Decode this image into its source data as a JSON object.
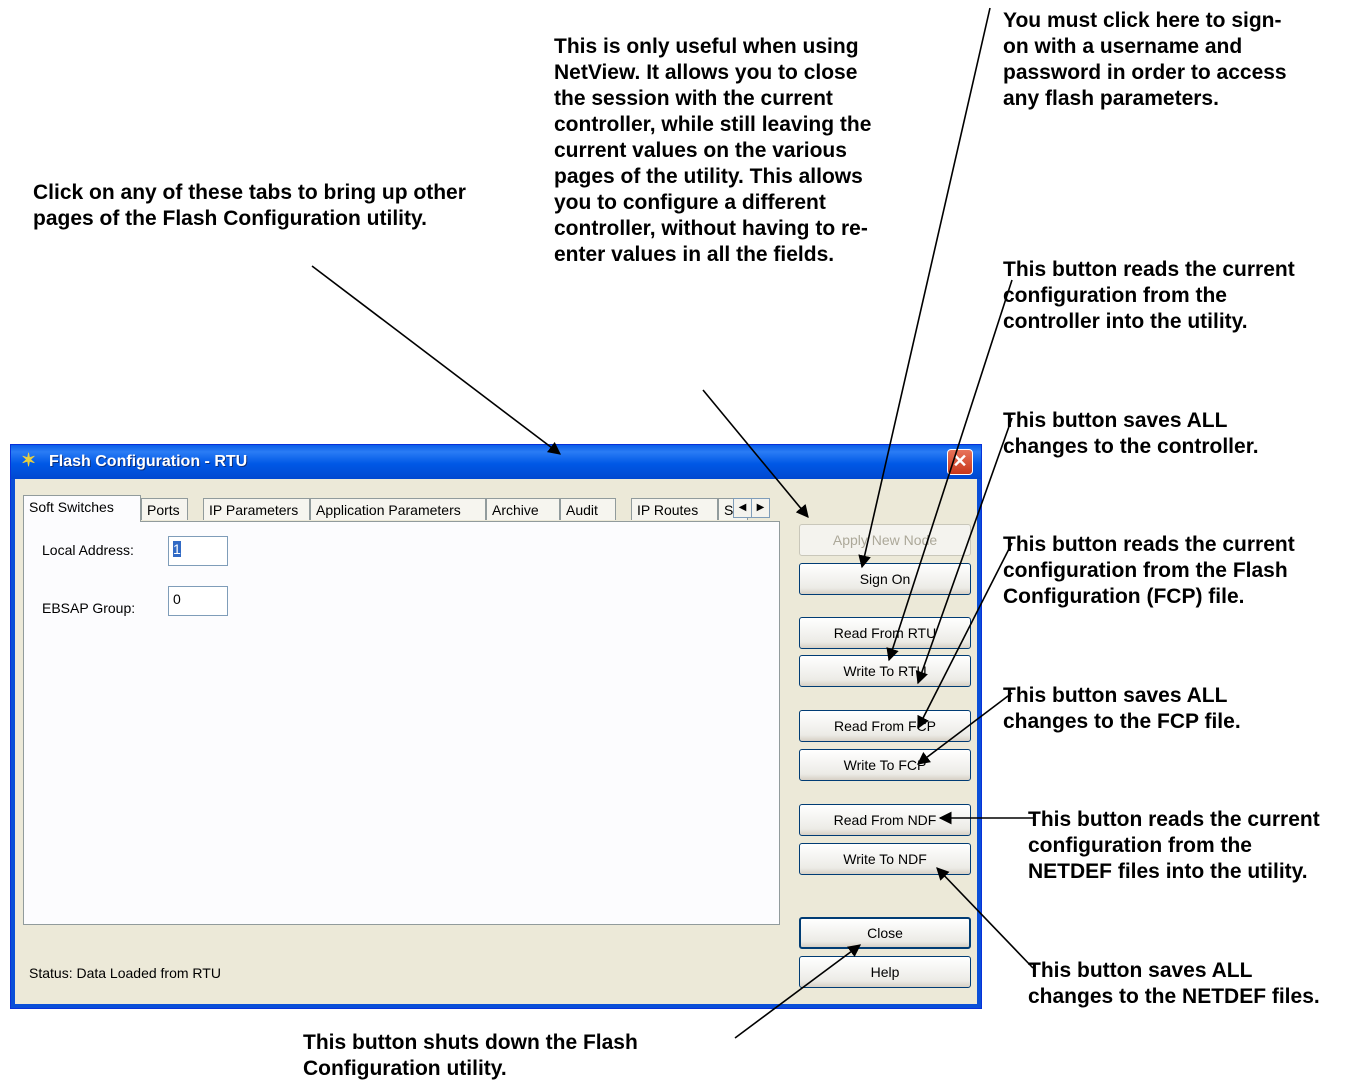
{
  "callouts": {
    "tabs": "Click on any of these tabs to bring up other pages of the Flash Configuration utility.",
    "apply_new_node": "This is only useful when using NetView. It allows you to close the session with the current controller, while still leaving the current values on the various pages of the utility. This allows you to configure a different controller, without having to re-enter values in all the fields.",
    "sign_on": "You must click here to sign-on with a username and password in order to access any flash parameters.",
    "read_rtu": "This button reads the current configuration from the controller into the utility.",
    "write_rtu": "This button saves ALL changes to the controller.",
    "read_fcp": "This button reads the current configuration from the Flash Configuration (FCP) file.",
    "write_fcp": "This button saves ALL changes to the FCP file.",
    "read_ndf": "This button reads the current configuration from the NETDEF files into the utility.",
    "write_ndf": "This button saves ALL changes to the NETDEF files.",
    "close": "This button shuts down the Flash Configuration utility."
  },
  "window": {
    "title": "Flash Configuration - RTU",
    "close_glyph": "✕"
  },
  "tabs": [
    "Soft Switches",
    "Ports",
    "IP Parameters",
    "Application Parameters",
    "Archive",
    "Audit",
    "IP Routes",
    "S"
  ],
  "fields": {
    "local_address_label": "Local Address:",
    "local_address_value": "1",
    "ebsap_group_label": "EBSAP Group:",
    "ebsap_group_value": "0"
  },
  "buttons": {
    "apply_new_node": "Apply New Node",
    "sign_on": "Sign On",
    "read_from_rtu": "Read From RTU",
    "write_to_rtu": "Write To RTU",
    "read_from_fcp": "Read From FCP",
    "write_to_fcp": "Write To FCP",
    "read_from_ndf": "Read From NDF",
    "write_to_ndf": "Write To NDF",
    "close": "Close",
    "help": "Help"
  },
  "status": "Status:  Data Loaded from RTU"
}
